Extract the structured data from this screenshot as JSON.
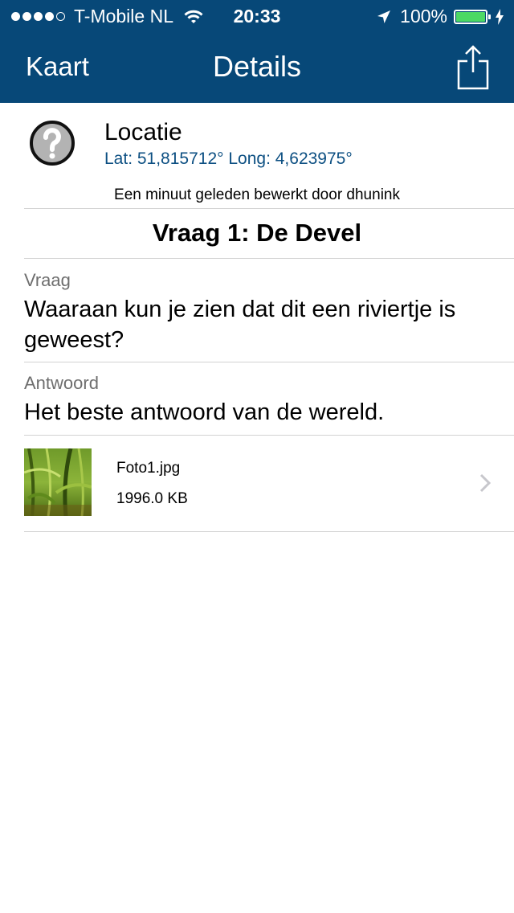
{
  "status": {
    "carrier": "T-Mobile NL",
    "time": "20:33",
    "battery": "100%",
    "signal_bars_filled": 4,
    "signal_bars_total": 5,
    "battery_level": 1.0,
    "icons": [
      "signal-dots-icon",
      "wifi-icon",
      "location-arrow-icon",
      "battery-icon",
      "charging-bolt-icon"
    ]
  },
  "nav": {
    "back_label": "Kaart",
    "title": "Details",
    "share_icon": "share-icon"
  },
  "location": {
    "icon": "question-mark-icon",
    "title": "Locatie",
    "coords": "Lat: 51,815712° Long: 4,623975°",
    "edited": "Een minuut geleden bewerkt door dhunink"
  },
  "question": {
    "title": "Vraag 1: De Devel",
    "vraag_label": "Vraag",
    "vraag_text": "Waaraan kun je zien dat dit een riviertje is geweest?",
    "antwoord_label": "Antwoord",
    "antwoord_text": "Het beste antwoord van de wereld."
  },
  "attachment": {
    "filename": "Foto1.jpg",
    "size": "1996.0 KB"
  },
  "colors": {
    "nav_bg": "#074878",
    "coords_text": "#0c4f82",
    "battery_fill": "#4cd964"
  }
}
